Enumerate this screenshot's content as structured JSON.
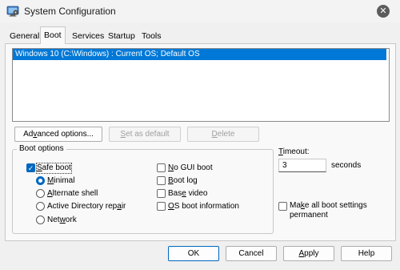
{
  "window": {
    "title": "System Configuration",
    "app_icon": "system-config-icon",
    "close_icon": "close-icon"
  },
  "tabs": [
    {
      "label": "General",
      "active": false
    },
    {
      "label": "Boot",
      "active": true
    },
    {
      "label": "Services",
      "active": false
    },
    {
      "label": "Startup",
      "active": false
    },
    {
      "label": "Tools",
      "active": false
    }
  ],
  "boot_list": {
    "entries": [
      "Windows 10 (C:\\Windows) : Current OS; Default OS"
    ],
    "selected_index": 0
  },
  "list_buttons": {
    "advanced": {
      "pre": "Ad",
      "ul": "v",
      "post": "anced options..."
    },
    "set_default": {
      "pre": "",
      "ul": "S",
      "post": "et as default"
    },
    "delete": {
      "pre": "",
      "ul": "D",
      "post": "elete"
    }
  },
  "boot_options": {
    "group_label": "Boot options",
    "safe_boot": {
      "pre": "",
      "ul": "S",
      "post": "afe boot",
      "checked": true
    },
    "radios": [
      {
        "pre": "",
        "ul": "M",
        "post": "inimal",
        "checked": true
      },
      {
        "pre": "",
        "ul": "A",
        "post": "lternate shell",
        "checked": false
      },
      {
        "pre": "Active Directory rep",
        "ul": "a",
        "post": "ir",
        "checked": false
      },
      {
        "pre": "Net",
        "ul": "w",
        "post": "ork",
        "checked": false
      }
    ],
    "checks": [
      {
        "pre": "",
        "ul": "N",
        "post": "o GUI boot",
        "checked": false
      },
      {
        "pre": "",
        "ul": "B",
        "post": "oot log",
        "checked": false
      },
      {
        "pre": "Bas",
        "ul": "e",
        "post": " video",
        "checked": false
      },
      {
        "pre": "",
        "ul": "O",
        "post": "S boot information",
        "checked": false
      }
    ]
  },
  "timeout": {
    "label_pre": "",
    "label_ul": "T",
    "label_post": "imeout:",
    "value": "3",
    "unit": "seconds"
  },
  "make_permanent": {
    "line1_pre": "Ma",
    "line1_ul": "k",
    "line1_post": "e all boot settings",
    "line2": "permanent",
    "checked": false
  },
  "footer": {
    "ok": "OK",
    "cancel": "Cancel",
    "apply": {
      "pre": "",
      "ul": "A",
      "post": "pply"
    },
    "help": "Help"
  },
  "colors": {
    "accent": "#0067c0",
    "selection": "#0078d7",
    "window_bg": "#f0f0f0",
    "panel_bg": "#f9f9f9"
  }
}
